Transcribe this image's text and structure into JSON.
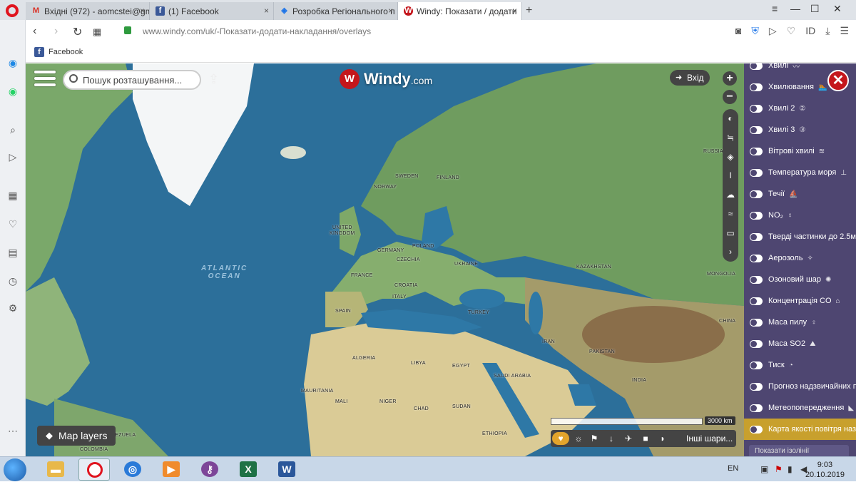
{
  "browser": {
    "tabs": [
      {
        "label": "Вхідні (972) - aomcstei@gm",
        "icon": "gmail-icon",
        "color": "#d93025",
        "glyph": "M"
      },
      {
        "label": "(1) Facebook",
        "icon": "facebook-icon",
        "color": "#3b5998",
        "glyph": "f"
      },
      {
        "label": "Розробка Регіонального п",
        "icon": "globe-icon",
        "color": "#1a73e8",
        "glyph": "◈"
      },
      {
        "label": "Windy: Показати / додати",
        "icon": "windy-icon",
        "color": "#c4161c",
        "glyph": "W"
      }
    ],
    "url": "www.windy.com/uk/-Показати-додати-накладання/overlays",
    "bookmarks": [
      {
        "label": "Facebook"
      }
    ]
  },
  "map": {
    "search_placeholder": "Пошук розташування...",
    "logo_brand": "Windy",
    "logo_suffix": ".com",
    "login_label": "Вхід",
    "map_layers_label": "Map layers",
    "scale_label": "3000 km",
    "more_layers_label": "Інші шари...",
    "ocean_label_1": "ATLANTIC",
    "ocean_label_2": "OCEAN",
    "countries": [
      {
        "name": "SWEDEN"
      },
      {
        "name": "FINLAND"
      },
      {
        "name": "NORWAY"
      },
      {
        "name": "UNITED"
      },
      {
        "name": "KINGDOM"
      },
      {
        "name": "POLAND"
      },
      {
        "name": "GERMANY"
      },
      {
        "name": "CZECHIA"
      },
      {
        "name": "UKRAINE"
      },
      {
        "name": "FRANCE"
      },
      {
        "name": "CROATIA"
      },
      {
        "name": "ITALY"
      },
      {
        "name": "SPAIN"
      },
      {
        "name": "TURKEY"
      },
      {
        "name": "KAZAKHSTAN"
      },
      {
        "name": "MONGOLIA"
      },
      {
        "name": "RUSSIA"
      },
      {
        "name": "CHINA"
      },
      {
        "name": "IRAN"
      },
      {
        "name": "PAKISTAN"
      },
      {
        "name": "INDIA"
      },
      {
        "name": "ALGERIA"
      },
      {
        "name": "LIBYA"
      },
      {
        "name": "EGYPT"
      },
      {
        "name": "SAUDI ARABIA"
      },
      {
        "name": "MAURITANIA"
      },
      {
        "name": "MALI"
      },
      {
        "name": "NIGER"
      },
      {
        "name": "CHAD"
      },
      {
        "name": "SUDAN"
      },
      {
        "name": "ETHIOPIA"
      },
      {
        "name": "COLOMBIA"
      },
      {
        "name": "VENEZUELA"
      }
    ]
  },
  "overlays": {
    "items": [
      {
        "label": "Хвилі",
        "icon": "wave-icon",
        "glyph": "〰",
        "on": false,
        "partial": true
      },
      {
        "label": "Хвилювання",
        "icon": "swimmer-icon",
        "glyph": "🏊",
        "on": false
      },
      {
        "label": "Хвилі 2",
        "icon": "number-two-icon",
        "glyph": "②",
        "on": false
      },
      {
        "label": "Хвилі 3",
        "icon": "number-three-icon",
        "glyph": "③",
        "on": false
      },
      {
        "label": "Вітрові хвилі",
        "icon": "wind-wave-icon",
        "glyph": "≋",
        "on": false
      },
      {
        "label": "Температура моря",
        "icon": "thermometer-icon",
        "glyph": "⊥",
        "on": false
      },
      {
        "label": "Течії",
        "icon": "current-icon",
        "glyph": "⛵",
        "on": false
      },
      {
        "label": "NO₂",
        "icon": "particle-icon",
        "glyph": "♀",
        "on": false
      },
      {
        "label": "Тверді частинки до 2.5мк",
        "icon": "",
        "glyph": "",
        "on": false
      },
      {
        "label": "Аерозоль",
        "icon": "aerosol-icon",
        "glyph": "✧",
        "on": false
      },
      {
        "label": "Озоновий шар",
        "icon": "ozone-icon",
        "glyph": "✺",
        "on": false
      },
      {
        "label": "Концентрація CO",
        "icon": "factory-icon",
        "glyph": "⌂",
        "on": false
      },
      {
        "label": "Маса пилу",
        "icon": "dust-icon",
        "glyph": "♀",
        "on": false
      },
      {
        "label": "Маса SO2",
        "icon": "volcano-icon",
        "glyph": "⛰",
        "on": false
      },
      {
        "label": "Тиск",
        "icon": "gauge-icon",
        "glyph": "◔",
        "on": false
      },
      {
        "label": "Прогноз надзвичайних п",
        "icon": "",
        "glyph": "",
        "on": false
      },
      {
        "label": "Метеопопередження",
        "icon": "warning-icon",
        "glyph": "◣",
        "on": false
      },
      {
        "label": "Карта якості повітря назо",
        "icon": "",
        "glyph": "",
        "on": false,
        "highlight": true
      }
    ],
    "more_label": "Показати ізолінії",
    "colors": {
      "panel": "#4e4671",
      "highlight": "#c8a02d",
      "close": "#c4161c"
    }
  },
  "taskbar": {
    "language": "EN",
    "time": "9:03",
    "date": "20.10.2019"
  }
}
